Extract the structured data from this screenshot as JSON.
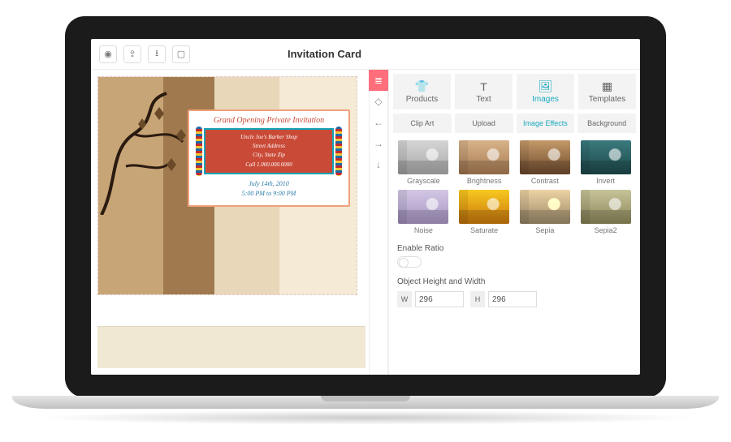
{
  "topbar": {
    "title": "Invitation Card"
  },
  "canvas": {
    "card": {
      "heading": "Grand Opening Private Invitation",
      "line1": "Uncle Joe's Barber Shop",
      "line2": "Street Address",
      "line3": "City,   State   Zip",
      "line4": "Call 1.000.000.0000",
      "date": "July 14th, 2010",
      "time": "5:00 PM to 9:00 PM"
    }
  },
  "tools": {
    "rail": [
      "layers",
      "eraser",
      "undo",
      "redo",
      "down"
    ]
  },
  "tabs": {
    "items": [
      {
        "label": "Products"
      },
      {
        "label": "Text"
      },
      {
        "label": "Images"
      },
      {
        "label": "Templates"
      }
    ],
    "active": "Images"
  },
  "subtabs": {
    "items": [
      {
        "label": "Clip Art"
      },
      {
        "label": "Upload"
      },
      {
        "label": "Image Effects"
      },
      {
        "label": "Background"
      }
    ],
    "active": "Image Effects"
  },
  "effects": [
    {
      "label": "Grayscale"
    },
    {
      "label": "Brightness"
    },
    {
      "label": "Contrast"
    },
    {
      "label": "Invert"
    },
    {
      "label": "Noise"
    },
    {
      "label": "Saturate"
    },
    {
      "label": "Sepia"
    },
    {
      "label": "Sepia2"
    }
  ],
  "panel": {
    "ratio_label": "Enable Ratio",
    "dim_label": "Object Height and Width",
    "w_label": "W",
    "h_label": "H",
    "width": "296",
    "height": "296"
  }
}
